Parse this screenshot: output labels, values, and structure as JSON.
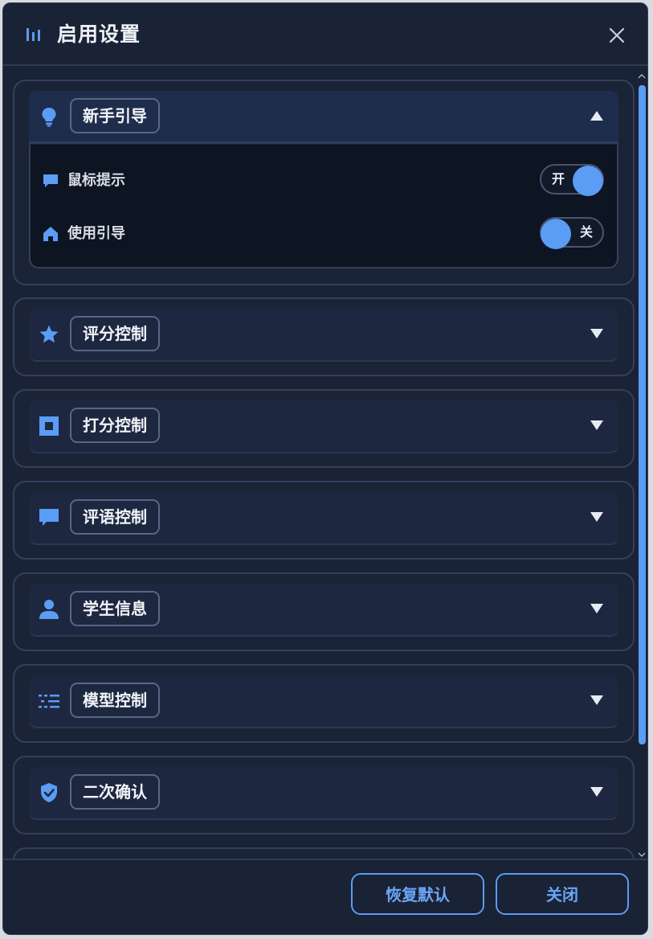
{
  "dialog": {
    "title": "启用设置",
    "title_icon": "bars-icon",
    "close_icon": "close-icon"
  },
  "sections": [
    {
      "id": "guide",
      "label": "新手引导",
      "icon": "lightbulb-icon",
      "expanded": true,
      "options": [
        {
          "label": "鼠标提示",
          "icon": "comment-icon",
          "state": "on",
          "state_label": "开"
        },
        {
          "label": "使用引导",
          "icon": "home-icon",
          "state": "off",
          "state_label": "关"
        }
      ]
    },
    {
      "id": "rating",
      "label": "评分控制",
      "icon": "star-icon",
      "expanded": false
    },
    {
      "id": "scoring",
      "label": "打分控制",
      "icon": "square-icon",
      "expanded": false
    },
    {
      "id": "comment",
      "label": "评语控制",
      "icon": "comment-icon",
      "expanded": false
    },
    {
      "id": "student",
      "label": "学生信息",
      "icon": "user-icon",
      "expanded": false
    },
    {
      "id": "model",
      "label": "模型控制",
      "icon": "list-icon",
      "expanded": false
    },
    {
      "id": "confirm",
      "label": "二次确认",
      "icon": "shield-check-icon",
      "expanded": false
    }
  ],
  "footer": {
    "reset_label": "恢复默认",
    "close_label": "关闭"
  },
  "colors": {
    "accent": "#5b9cf4",
    "background": "#1a2235",
    "panel_border": "#34405a",
    "body_dark": "#0d1422"
  }
}
